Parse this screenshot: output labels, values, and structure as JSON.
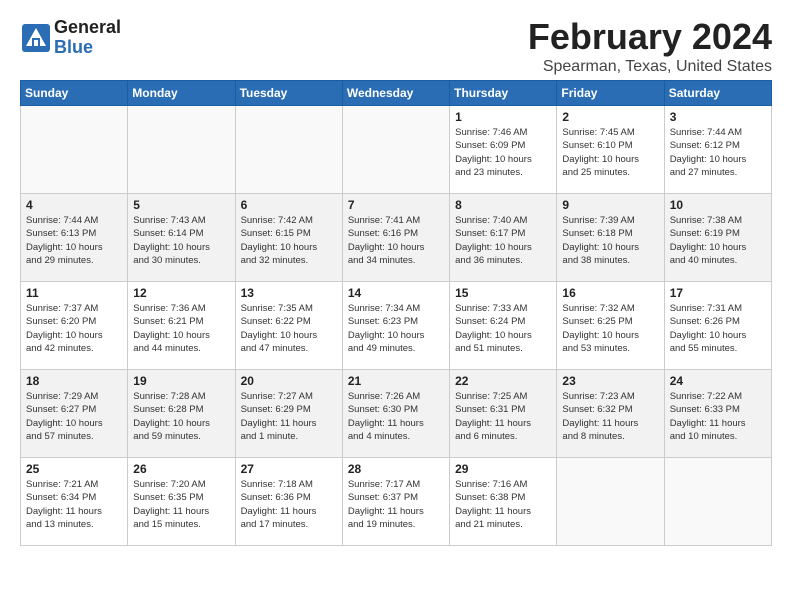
{
  "logo": {
    "line1": "General",
    "line2": "Blue"
  },
  "header": {
    "month_year": "February 2024",
    "location": "Spearman, Texas, United States"
  },
  "days_of_week": [
    "Sunday",
    "Monday",
    "Tuesday",
    "Wednesday",
    "Thursday",
    "Friday",
    "Saturday"
  ],
  "weeks": [
    [
      {
        "day": "",
        "info": ""
      },
      {
        "day": "",
        "info": ""
      },
      {
        "day": "",
        "info": ""
      },
      {
        "day": "",
        "info": ""
      },
      {
        "day": "1",
        "info": "Sunrise: 7:46 AM\nSunset: 6:09 PM\nDaylight: 10 hours\nand 23 minutes."
      },
      {
        "day": "2",
        "info": "Sunrise: 7:45 AM\nSunset: 6:10 PM\nDaylight: 10 hours\nand 25 minutes."
      },
      {
        "day": "3",
        "info": "Sunrise: 7:44 AM\nSunset: 6:12 PM\nDaylight: 10 hours\nand 27 minutes."
      }
    ],
    [
      {
        "day": "4",
        "info": "Sunrise: 7:44 AM\nSunset: 6:13 PM\nDaylight: 10 hours\nand 29 minutes."
      },
      {
        "day": "5",
        "info": "Sunrise: 7:43 AM\nSunset: 6:14 PM\nDaylight: 10 hours\nand 30 minutes."
      },
      {
        "day": "6",
        "info": "Sunrise: 7:42 AM\nSunset: 6:15 PM\nDaylight: 10 hours\nand 32 minutes."
      },
      {
        "day": "7",
        "info": "Sunrise: 7:41 AM\nSunset: 6:16 PM\nDaylight: 10 hours\nand 34 minutes."
      },
      {
        "day": "8",
        "info": "Sunrise: 7:40 AM\nSunset: 6:17 PM\nDaylight: 10 hours\nand 36 minutes."
      },
      {
        "day": "9",
        "info": "Sunrise: 7:39 AM\nSunset: 6:18 PM\nDaylight: 10 hours\nand 38 minutes."
      },
      {
        "day": "10",
        "info": "Sunrise: 7:38 AM\nSunset: 6:19 PM\nDaylight: 10 hours\nand 40 minutes."
      }
    ],
    [
      {
        "day": "11",
        "info": "Sunrise: 7:37 AM\nSunset: 6:20 PM\nDaylight: 10 hours\nand 42 minutes."
      },
      {
        "day": "12",
        "info": "Sunrise: 7:36 AM\nSunset: 6:21 PM\nDaylight: 10 hours\nand 44 minutes."
      },
      {
        "day": "13",
        "info": "Sunrise: 7:35 AM\nSunset: 6:22 PM\nDaylight: 10 hours\nand 47 minutes."
      },
      {
        "day": "14",
        "info": "Sunrise: 7:34 AM\nSunset: 6:23 PM\nDaylight: 10 hours\nand 49 minutes."
      },
      {
        "day": "15",
        "info": "Sunrise: 7:33 AM\nSunset: 6:24 PM\nDaylight: 10 hours\nand 51 minutes."
      },
      {
        "day": "16",
        "info": "Sunrise: 7:32 AM\nSunset: 6:25 PM\nDaylight: 10 hours\nand 53 minutes."
      },
      {
        "day": "17",
        "info": "Sunrise: 7:31 AM\nSunset: 6:26 PM\nDaylight: 10 hours\nand 55 minutes."
      }
    ],
    [
      {
        "day": "18",
        "info": "Sunrise: 7:29 AM\nSunset: 6:27 PM\nDaylight: 10 hours\nand 57 minutes."
      },
      {
        "day": "19",
        "info": "Sunrise: 7:28 AM\nSunset: 6:28 PM\nDaylight: 10 hours\nand 59 minutes."
      },
      {
        "day": "20",
        "info": "Sunrise: 7:27 AM\nSunset: 6:29 PM\nDaylight: 11 hours\nand 1 minute."
      },
      {
        "day": "21",
        "info": "Sunrise: 7:26 AM\nSunset: 6:30 PM\nDaylight: 11 hours\nand 4 minutes."
      },
      {
        "day": "22",
        "info": "Sunrise: 7:25 AM\nSunset: 6:31 PM\nDaylight: 11 hours\nand 6 minutes."
      },
      {
        "day": "23",
        "info": "Sunrise: 7:23 AM\nSunset: 6:32 PM\nDaylight: 11 hours\nand 8 minutes."
      },
      {
        "day": "24",
        "info": "Sunrise: 7:22 AM\nSunset: 6:33 PM\nDaylight: 11 hours\nand 10 minutes."
      }
    ],
    [
      {
        "day": "25",
        "info": "Sunrise: 7:21 AM\nSunset: 6:34 PM\nDaylight: 11 hours\nand 13 minutes."
      },
      {
        "day": "26",
        "info": "Sunrise: 7:20 AM\nSunset: 6:35 PM\nDaylight: 11 hours\nand 15 minutes."
      },
      {
        "day": "27",
        "info": "Sunrise: 7:18 AM\nSunset: 6:36 PM\nDaylight: 11 hours\nand 17 minutes."
      },
      {
        "day": "28",
        "info": "Sunrise: 7:17 AM\nSunset: 6:37 PM\nDaylight: 11 hours\nand 19 minutes."
      },
      {
        "day": "29",
        "info": "Sunrise: 7:16 AM\nSunset: 6:38 PM\nDaylight: 11 hours\nand 21 minutes."
      },
      {
        "day": "",
        "info": ""
      },
      {
        "day": "",
        "info": ""
      }
    ]
  ]
}
